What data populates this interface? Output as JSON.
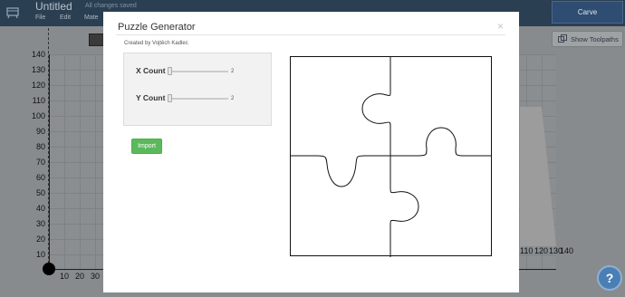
{
  "app": {
    "document_title": "Untitled",
    "save_status": "All changes saved",
    "menu": [
      "File",
      "Edit",
      "Mate"
    ],
    "carve_label": "Carve",
    "show_toolpaths_label": "Show Toolpaths",
    "help_label": "?"
  },
  "axis": {
    "y_ticks": [
      "140",
      "130",
      "120",
      "110",
      "100",
      "90",
      "80",
      "70",
      "60",
      "50",
      "40",
      "30",
      "20",
      "10"
    ],
    "x_ticks_left": [
      "10",
      "20",
      "30"
    ],
    "x_ticks_right": [
      "110",
      "120",
      "130",
      "140"
    ]
  },
  "modal": {
    "title": "Puzzle Generator",
    "close_label": "×",
    "author": "Created by Vojtěch Kadlec",
    "x_count": {
      "label": "X Count",
      "value": "2",
      "fraction": 0
    },
    "y_count": {
      "label": "Y Count",
      "value": "2",
      "fraction": 0
    },
    "import_label": "Import"
  },
  "icons": {
    "app_logo": "cnc-machine-icon",
    "toolpaths": "toolpaths-icon",
    "help": "help-question-icon"
  }
}
